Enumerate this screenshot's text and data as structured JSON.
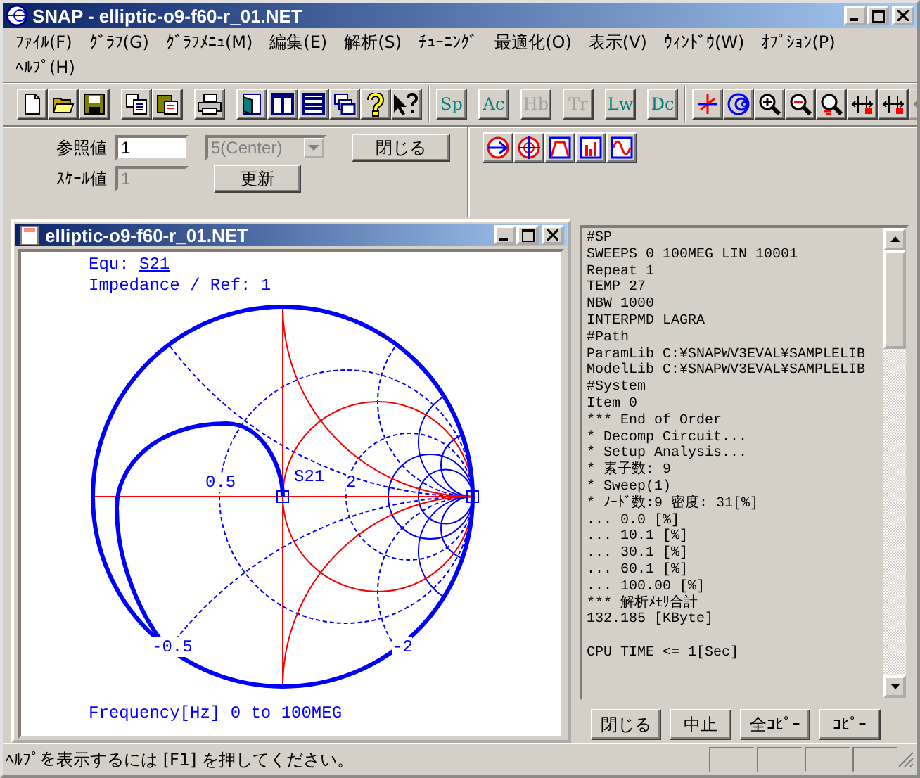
{
  "window": {
    "title": "SNAP - elliptic-o9-f60-r_01.NET"
  },
  "menu": [
    "ﾌｧｲﾙ(F)",
    "ｸﾞﾗﾌ(G)",
    "ｸﾞﾗﾌﾒﾆｭ(M)",
    "編集(E)",
    "解析(S)",
    "ﾁｭｰﾆﾝｸﾞ",
    "最適化(O)",
    "表示(V)",
    "ｳｨﾝﾄﾞｳ(W)",
    "ｵﾌﾟｼｮﾝ(P)",
    "ﾍﾙﾌﾟ(H)"
  ],
  "toolbar": {
    "file_tools": [
      {
        "kind": "new"
      },
      {
        "kind": "open"
      },
      {
        "kind": "save"
      }
    ],
    "edit_tools": [
      {
        "kind": "copy"
      },
      {
        "kind": "paste"
      }
    ],
    "print_tools": [
      {
        "kind": "print"
      }
    ],
    "window_tools": [
      {
        "kind": "door"
      },
      {
        "kind": "columns"
      },
      {
        "kind": "rows"
      },
      {
        "kind": "cascade"
      },
      {
        "kind": "help"
      },
      {
        "kind": "context-help"
      }
    ],
    "analysis_modes": [
      {
        "label": "Sp",
        "disabled": false
      },
      {
        "label": "Ac",
        "disabled": false
      },
      {
        "label": "Hb",
        "disabled": true
      },
      {
        "label": "Tr",
        "disabled": true
      },
      {
        "label": "Lw",
        "disabled": false
      },
      {
        "label": "Dc",
        "disabled": false
      }
    ],
    "graph_tools": [
      {
        "kind": "marker",
        "disabled": false
      },
      {
        "kind": "smith",
        "disabled": false
      },
      {
        "kind": "zoom-in",
        "disabled": false
      },
      {
        "kind": "zoom-out",
        "disabled": false
      },
      {
        "kind": "zoom-all",
        "disabled": false
      },
      {
        "kind": "marker-1",
        "disabled": false
      },
      {
        "kind": "marker-2",
        "disabled": false
      },
      {
        "kind": "marker-3",
        "disabled": true
      }
    ]
  },
  "graph_panel": {
    "reference_label": "参照値",
    "reference_value": "1",
    "center_select": {
      "value": "5(Center)",
      "disabled": true
    },
    "close_button": "閉じる",
    "scale_label": "ｽｹｰﾙ値",
    "scale_value": "1",
    "scale_disabled": true,
    "update_button": "更新"
  },
  "chart_type_tools": [
    {
      "kind": "smith-arrow"
    },
    {
      "kind": "polar"
    },
    {
      "kind": "filter"
    },
    {
      "kind": "bars"
    },
    {
      "kind": "wave"
    }
  ],
  "graph_window": {
    "title": "elliptic-o9-f60-r_01.NET",
    "equation_label": "Equ:",
    "equation": "S21",
    "impedance": "Impedance / Ref: 1",
    "axis_labels": [
      "0.5",
      "2",
      "-0.5",
      "-2"
    ],
    "trace_label": "S21",
    "frequency": "Frequency[Hz] 0 to 100MEG"
  },
  "log_panel": {
    "lines": [
      {
        "text": "#SP",
        "spaced": false
      },
      {
        "text": "SWEEPS 0 100MEG LIN 10001",
        "spaced": false
      },
      {
        "text": "Repeat 1",
        "spaced": false
      },
      {
        "text": "TEMP 27",
        "spaced": false
      },
      {
        "text": "NBW 1000",
        "spaced": false
      },
      {
        "text": "INTERPMD LAGRA",
        "spaced": false
      },
      {
        "text": "#Path",
        "spaced": false
      },
      {
        "text": "ParamLib C:¥SNAPWV3EVAL¥SAMPLELIB",
        "spaced": false
      },
      {
        "text": "ModelLib C:¥SNAPWV3EVAL¥SAMPLELIB",
        "spaced": false
      },
      {
        "text": "#System",
        "spaced": false
      },
      {
        "text": "Item 0",
        "spaced": false
      },
      {
        "text": "*** End of Order",
        "spaced": false
      },
      {
        "text": "* Decomp Circuit...",
        "spaced": false
      },
      {
        "text": "* Setup Analysis...",
        "spaced": false
      },
      {
        "text": "* 素子数: 9",
        "spaced": false
      },
      {
        "text": "* Sweep(1)",
        "spaced": false
      },
      {
        "text": "* ﾉｰﾄﾞ数:9 密度: 31[%]",
        "spaced": false
      },
      {
        "text": "... 0.0 [%]",
        "spaced": false
      },
      {
        "text": "... 10.1 [%]",
        "spaced": false
      },
      {
        "text": "... 30.1 [%]",
        "spaced": false
      },
      {
        "text": "... 60.1 [%]",
        "spaced": false
      },
      {
        "text": "... 100.00 [%]",
        "spaced": false
      },
      {
        "text": "*** 解析ﾒﾓﾘ合計",
        "spaced": false
      },
      {
        "text": "132.185 [KByte]",
        "spaced": false
      },
      {
        "text": "CPU TIME <= 1[Sec]",
        "spaced": true
      }
    ],
    "buttons": [
      "閉じる",
      "中止",
      "全ｺﾋﾟｰ",
      "ｺﾋﾟｰ"
    ]
  },
  "status_bar": {
    "text": "ﾍﾙﾌﾟを表示するには [F1] を押してください。"
  }
}
